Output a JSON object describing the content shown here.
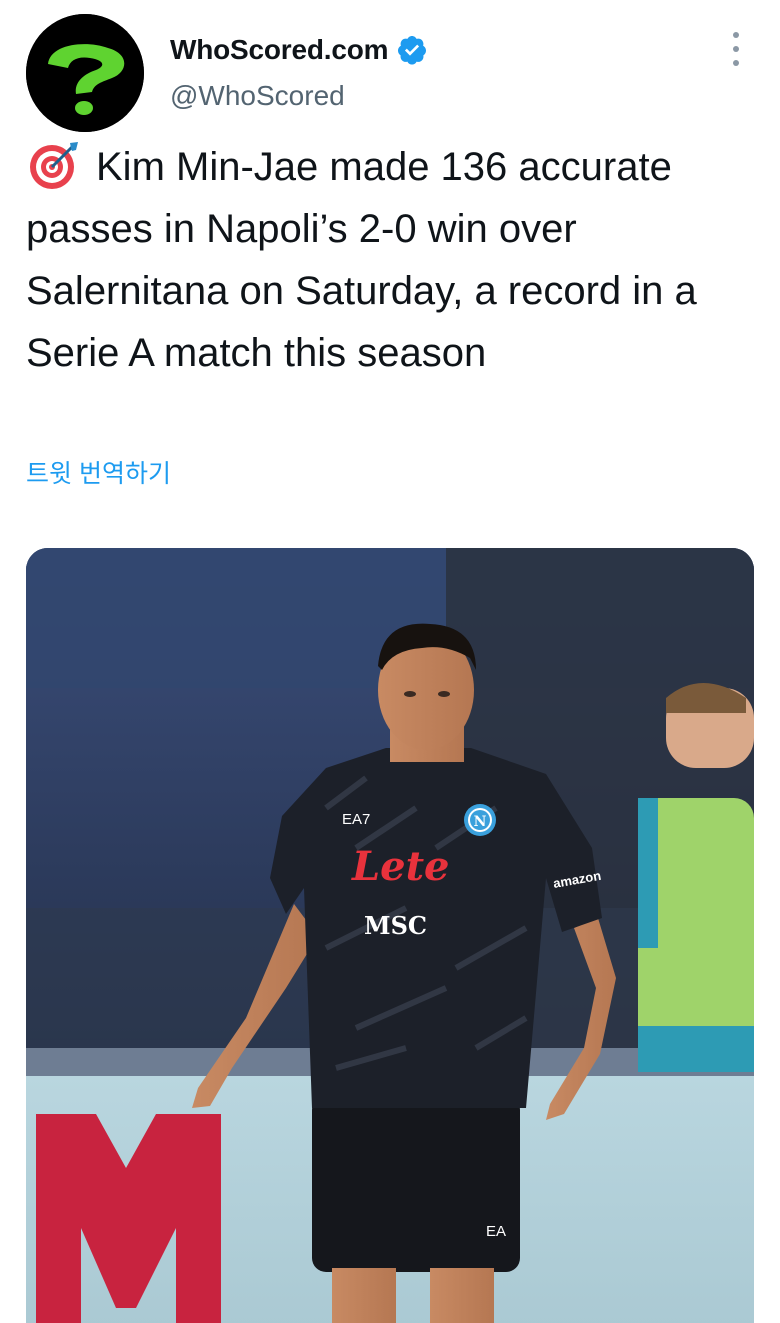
{
  "author": {
    "display_name": "WhoScored.com",
    "handle": "@WhoScored",
    "verified": true,
    "avatar_icon": "green-question-mark-logo"
  },
  "tweet": {
    "emoji_icon": "direct-hit-target-icon",
    "text": "Kim Min-Jae made 136 accurate passes in Napoli’s 2-0 win over Salernitana on Saturday, a record in a Serie A match this season",
    "translate_label": "트윗 번역하기"
  },
  "media": {
    "jersey": {
      "maker": "EA7",
      "sponsor": "Lete",
      "sponsor2": "MSC",
      "sleeve": "amazon",
      "crest": "N",
      "shorts_mark": "EA"
    },
    "description_icon": "football-player-photo"
  },
  "colors": {
    "link": "#1d9bf0",
    "verified": "#1d9bf0",
    "text": "#0f1419",
    "secondary": "#536471",
    "logo_green": "#5fd330"
  }
}
